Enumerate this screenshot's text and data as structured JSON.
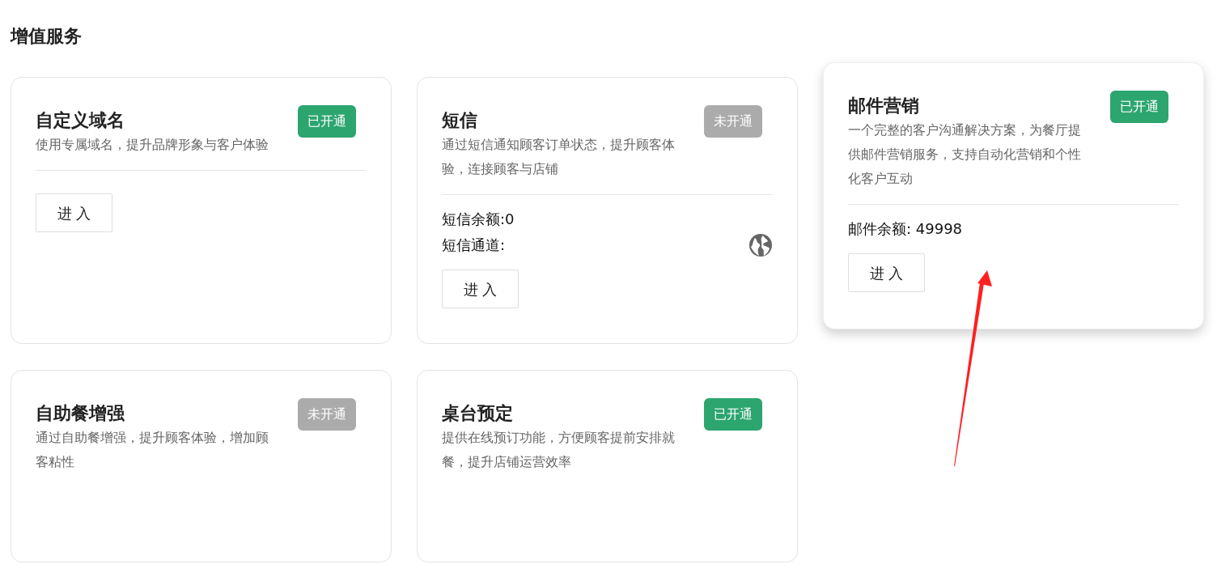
{
  "page_title": "增值服务",
  "cards": [
    {
      "title": "自定义域名",
      "status": {
        "label": "已开通",
        "enabled": true
      },
      "description": "使用专属域名，提升品牌形象与客户体验",
      "raised": false,
      "button": "进 入"
    },
    {
      "title": "短信",
      "status": {
        "label": "未开通",
        "enabled": false
      },
      "description": "通过短信通知顾客订单状态，提升顾客体验，连接顾客与店铺",
      "raised": false,
      "details": [
        {
          "kind": "text",
          "text": "短信余额:0"
        },
        {
          "kind": "channel",
          "text": "短信通道:"
        }
      ],
      "button": "进 入"
    },
    {
      "title": "邮件营销",
      "status": {
        "label": "已开通",
        "enabled": true
      },
      "description": "一个完整的客户沟通解决方案，为餐厅提供邮件营销服务，支持自动化营销和个性化客户互动",
      "raised": true,
      "details": [
        {
          "kind": "text",
          "text": "邮件余额: 49998"
        }
      ],
      "button": "进 入"
    },
    {
      "title": "自助餐增强",
      "status": {
        "label": "未开通",
        "enabled": false
      },
      "description": "通过自助餐增强，提升顾客体验，增加顾客粘性",
      "raised": false
    },
    {
      "title": "桌台预定",
      "status": {
        "label": "已开通",
        "enabled": true
      },
      "description": "提供在线预订功能，方便顾客提前安排就餐，提升店铺运营效率",
      "raised": false
    }
  ]
}
